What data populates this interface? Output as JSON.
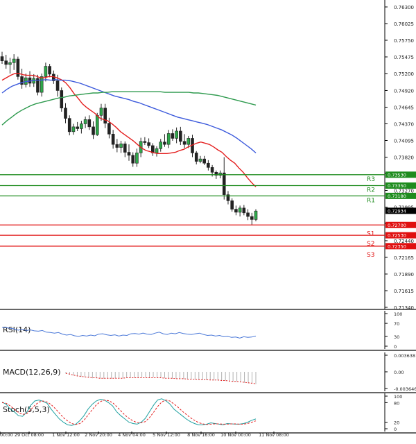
{
  "chart_data": {
    "type": "candlestick",
    "price_axis": {
      "ylim": [
        0.7134,
        0.763
      ],
      "ticks": [
        "0.76300",
        "0.76025",
        "0.75750",
        "0.75475",
        "0.75200",
        "0.74920",
        "0.74645",
        "0.74370",
        "0.74095",
        "0.73820",
        "0.73545",
        "0.73270",
        "0.72995",
        "0.72720",
        "0.72440",
        "0.72165",
        "0.71890",
        "0.71615",
        "0.71340"
      ]
    },
    "x_ticks": [
      "00:00",
      "29 Oct 08:00",
      "1 Nov 12:00",
      "2 Nov 20:00",
      "4 Nov 04:00",
      "5 Nov 12:00",
      "8 Nov 16:00",
      "10 Nov 00:00",
      "11 Nov 08:00"
    ],
    "current_price": {
      "label": "0.72934",
      "value": 0.72934
    },
    "levels": [
      {
        "name": "R3",
        "value": 0.7353,
        "label": "0.73530",
        "color": "#1e8c1e"
      },
      {
        "name": "R2",
        "value": 0.7335,
        "label": "0.73350",
        "color": "#1e8c1e"
      },
      {
        "name": "R1",
        "value": 0.7318,
        "label": "0.73180",
        "color": "#1e8c1e"
      },
      {
        "name": "S1",
        "value": 0.727,
        "label": "0.72700",
        "color": "#e01010"
      },
      {
        "name": "S2",
        "value": 0.7253,
        "label": "0.72530",
        "color": "#e01010"
      },
      {
        "name": "S3",
        "value": 0.7235,
        "label": "0.72350",
        "color": "#e01010"
      }
    ],
    "candles": [
      {
        "o": 0.7548,
        "h": 0.7556,
        "l": 0.7536,
        "c": 0.7541
      },
      {
        "o": 0.7541,
        "h": 0.7551,
        "l": 0.7528,
        "c": 0.7535
      },
      {
        "o": 0.7535,
        "h": 0.7546,
        "l": 0.752,
        "c": 0.7538
      },
      {
        "o": 0.7538,
        "h": 0.7552,
        "l": 0.7526,
        "c": 0.7544
      },
      {
        "o": 0.7544,
        "h": 0.7548,
        "l": 0.751,
        "c": 0.7515
      },
      {
        "o": 0.7515,
        "h": 0.7528,
        "l": 0.7495,
        "c": 0.7502
      },
      {
        "o": 0.7502,
        "h": 0.752,
        "l": 0.7497,
        "c": 0.7513
      },
      {
        "o": 0.7513,
        "h": 0.7524,
        "l": 0.7498,
        "c": 0.7504
      },
      {
        "o": 0.7504,
        "h": 0.7519,
        "l": 0.7498,
        "c": 0.7512
      },
      {
        "o": 0.7512,
        "h": 0.7518,
        "l": 0.7484,
        "c": 0.7489
      },
      {
        "o": 0.7489,
        "h": 0.752,
        "l": 0.7482,
        "c": 0.7515
      },
      {
        "o": 0.7515,
        "h": 0.7538,
        "l": 0.7507,
        "c": 0.7532
      },
      {
        "o": 0.7532,
        "h": 0.7536,
        "l": 0.7514,
        "c": 0.7519
      },
      {
        "o": 0.7519,
        "h": 0.7525,
        "l": 0.7503,
        "c": 0.7508
      },
      {
        "o": 0.7508,
        "h": 0.7518,
        "l": 0.7482,
        "c": 0.7492
      },
      {
        "o": 0.7492,
        "h": 0.7497,
        "l": 0.7457,
        "c": 0.7463
      },
      {
        "o": 0.7463,
        "h": 0.7471,
        "l": 0.7438,
        "c": 0.7446
      },
      {
        "o": 0.7446,
        "h": 0.7451,
        "l": 0.7418,
        "c": 0.7424
      },
      {
        "o": 0.7424,
        "h": 0.7437,
        "l": 0.7419,
        "c": 0.7432
      },
      {
        "o": 0.7432,
        "h": 0.744,
        "l": 0.7425,
        "c": 0.7429
      },
      {
        "o": 0.7429,
        "h": 0.7442,
        "l": 0.7421,
        "c": 0.7437
      },
      {
        "o": 0.7437,
        "h": 0.7449,
        "l": 0.743,
        "c": 0.7444
      },
      {
        "o": 0.7444,
        "h": 0.7451,
        "l": 0.7427,
        "c": 0.7432
      },
      {
        "o": 0.7432,
        "h": 0.7441,
        "l": 0.7412,
        "c": 0.7419
      },
      {
        "o": 0.7419,
        "h": 0.7455,
        "l": 0.7417,
        "c": 0.7451
      },
      {
        "o": 0.7451,
        "h": 0.747,
        "l": 0.7442,
        "c": 0.7463
      },
      {
        "o": 0.7463,
        "h": 0.747,
        "l": 0.743,
        "c": 0.7438
      },
      {
        "o": 0.7438,
        "h": 0.7447,
        "l": 0.7413,
        "c": 0.742
      },
      {
        "o": 0.742,
        "h": 0.7427,
        "l": 0.7396,
        "c": 0.7403
      },
      {
        "o": 0.7403,
        "h": 0.7412,
        "l": 0.739,
        "c": 0.7398
      },
      {
        "o": 0.7398,
        "h": 0.7409,
        "l": 0.7389,
        "c": 0.7404
      },
      {
        "o": 0.7404,
        "h": 0.7408,
        "l": 0.7382,
        "c": 0.739
      },
      {
        "o": 0.739,
        "h": 0.7403,
        "l": 0.7376,
        "c": 0.7385
      },
      {
        "o": 0.7385,
        "h": 0.739,
        "l": 0.7366,
        "c": 0.7372
      },
      {
        "o": 0.7372,
        "h": 0.7396,
        "l": 0.7366,
        "c": 0.7389
      },
      {
        "o": 0.7389,
        "h": 0.7414,
        "l": 0.7382,
        "c": 0.7408
      },
      {
        "o": 0.7408,
        "h": 0.7415,
        "l": 0.7402,
        "c": 0.7406
      },
      {
        "o": 0.7406,
        "h": 0.7413,
        "l": 0.7397,
        "c": 0.7401
      },
      {
        "o": 0.7401,
        "h": 0.7405,
        "l": 0.7384,
        "c": 0.7389
      },
      {
        "o": 0.7389,
        "h": 0.74,
        "l": 0.7383,
        "c": 0.7396
      },
      {
        "o": 0.7396,
        "h": 0.7412,
        "l": 0.7391,
        "c": 0.7407
      },
      {
        "o": 0.7407,
        "h": 0.742,
        "l": 0.7399,
        "c": 0.7403
      },
      {
        "o": 0.7403,
        "h": 0.7427,
        "l": 0.7397,
        "c": 0.7421
      },
      {
        "o": 0.7421,
        "h": 0.7428,
        "l": 0.7409,
        "c": 0.7413
      },
      {
        "o": 0.7413,
        "h": 0.7431,
        "l": 0.7405,
        "c": 0.7425
      },
      {
        "o": 0.7425,
        "h": 0.7432,
        "l": 0.7402,
        "c": 0.7408
      },
      {
        "o": 0.7408,
        "h": 0.742,
        "l": 0.7397,
        "c": 0.7403
      },
      {
        "o": 0.7403,
        "h": 0.7417,
        "l": 0.7397,
        "c": 0.7413
      },
      {
        "o": 0.7413,
        "h": 0.7419,
        "l": 0.7382,
        "c": 0.7389
      },
      {
        "o": 0.7389,
        "h": 0.7392,
        "l": 0.737,
        "c": 0.7375
      },
      {
        "o": 0.7375,
        "h": 0.7384,
        "l": 0.7372,
        "c": 0.7379
      },
      {
        "o": 0.7379,
        "h": 0.7384,
        "l": 0.7369,
        "c": 0.7372
      },
      {
        "o": 0.7372,
        "h": 0.7377,
        "l": 0.736,
        "c": 0.7365
      },
      {
        "o": 0.7365,
        "h": 0.7369,
        "l": 0.735,
        "c": 0.7357
      },
      {
        "o": 0.7357,
        "h": 0.736,
        "l": 0.7346,
        "c": 0.7352
      },
      {
        "o": 0.7352,
        "h": 0.736,
        "l": 0.7347,
        "c": 0.7356
      },
      {
        "o": 0.7356,
        "h": 0.7382,
        "l": 0.7312,
        "c": 0.732
      },
      {
        "o": 0.732,
        "h": 0.7326,
        "l": 0.7304,
        "c": 0.731
      },
      {
        "o": 0.731,
        "h": 0.7314,
        "l": 0.7292,
        "c": 0.7296
      },
      {
        "o": 0.7296,
        "h": 0.7302,
        "l": 0.7286,
        "c": 0.7291
      },
      {
        "o": 0.7291,
        "h": 0.7302,
        "l": 0.7284,
        "c": 0.7298
      },
      {
        "o": 0.7298,
        "h": 0.7303,
        "l": 0.7286,
        "c": 0.729
      },
      {
        "o": 0.729,
        "h": 0.7296,
        "l": 0.7278,
        "c": 0.7284
      },
      {
        "o": 0.7284,
        "h": 0.729,
        "l": 0.727,
        "c": 0.7279
      },
      {
        "o": 0.7279,
        "h": 0.7296,
        "l": 0.7276,
        "c": 0.7293
      }
    ],
    "moving_averages": [
      {
        "color": "#e41e1e",
        "values": [
          0.7509,
          0.7513,
          0.7517,
          0.752,
          0.752,
          0.7518,
          0.7517,
          0.7517,
          0.7516,
          0.7513,
          0.7513,
          0.7515,
          0.7515,
          0.7513,
          0.751,
          0.7505,
          0.7497,
          0.7487,
          0.7479,
          0.747,
          0.7464,
          0.7459,
          0.7454,
          0.7447,
          0.7444,
          0.7442,
          0.7437,
          0.7431,
          0.7424,
          0.7419,
          0.7414,
          0.7409,
          0.7403,
          0.7397,
          0.7393,
          0.7391,
          0.7389,
          0.7388,
          0.7388,
          0.7388,
          0.7389,
          0.739,
          0.7393,
          0.7395,
          0.7399,
          0.7402,
          0.7405,
          0.7407,
          0.7405,
          0.7403,
          0.7399,
          0.7394,
          0.739,
          0.7383,
          0.7377,
          0.7372,
          0.7364,
          0.7357,
          0.7348,
          0.734,
          0.7333
        ]
      },
      {
        "color": "#3c5adc",
        "values": [
          0.7488,
          0.7494,
          0.7499,
          0.7502,
          0.7505,
          0.7507,
          0.7508,
          0.7509,
          0.7509,
          0.751,
          0.7509,
          0.751,
          0.7509,
          0.7509,
          0.7508,
          0.7506,
          0.7504,
          0.7501,
          0.7498,
          0.7495,
          0.7492,
          0.7489,
          0.7486,
          0.7483,
          0.7481,
          0.7479,
          0.7477,
          0.7474,
          0.7472,
          0.7469,
          0.7466,
          0.7463,
          0.746,
          0.7457,
          0.7454,
          0.7451,
          0.7448,
          0.7446,
          0.7444,
          0.7442,
          0.744,
          0.7438,
          0.7436,
          0.7433,
          0.743,
          0.7427,
          0.7423,
          0.7419,
          0.7414,
          0.7408,
          0.7402,
          0.7396,
          0.7389
        ]
      },
      {
        "color": "#2e9a4e",
        "values": [
          0.7435,
          0.7442,
          0.7448,
          0.7454,
          0.7459,
          0.7463,
          0.7467,
          0.747,
          0.7472,
          0.7474,
          0.7476,
          0.7478,
          0.748,
          0.7481,
          0.7483,
          0.7484,
          0.7485,
          0.7486,
          0.7487,
          0.7488,
          0.7488,
          0.7489,
          0.7489,
          0.749,
          0.749,
          0.749,
          0.749,
          0.749,
          0.749,
          0.749,
          0.749,
          0.749,
          0.749,
          0.749,
          0.7489,
          0.7489,
          0.7489,
          0.7489,
          0.7489,
          0.7489,
          0.7488,
          0.7488,
          0.7487,
          0.7486,
          0.7485,
          0.7484,
          0.7482,
          0.748,
          0.7478,
          0.7476,
          0.7474,
          0.7472,
          0.747,
          0.7468
        ]
      }
    ],
    "panels": [
      {
        "key": "rsi",
        "name": "RSI(14)",
        "ticks": [
          "100",
          "70",
          "30",
          "0"
        ],
        "ylim": [
          0,
          100
        ],
        "series": [
          {
            "color": "#4a78d8",
            "values": [
              58,
              57,
              55,
              53,
              49,
              52,
              48,
              50,
              47,
              46,
              48,
              43,
              42,
              40,
              42,
              37,
              34,
              36,
              32,
              30,
              33,
              31,
              34,
              32,
              37,
              38,
              35,
              33,
              35,
              31,
              34,
              33,
              38,
              39,
              37,
              40,
              37,
              36,
              40,
              43,
              38,
              36,
              40,
              38,
              42,
              39,
              37,
              36,
              38,
              40,
              36,
              33,
              34,
              31,
              33,
              29,
              30,
              27,
              28,
              25,
              29,
              27,
              28,
              31
            ]
          }
        ]
      },
      {
        "key": "macd",
        "name": "MACD(12,26,9)",
        "ticks": [
          "0.003638",
          "0.00",
          "-0.003646"
        ],
        "ylim": [
          -0.003646,
          0.003638
        ],
        "histogram": [
          -0.0004,
          -0.0006,
          -0.0008,
          -0.001,
          -0.0011,
          -0.0012,
          -0.0013,
          -0.0014,
          -0.0014,
          -0.0015,
          -0.0015,
          -0.0015,
          -0.0015,
          -0.0014,
          -0.0014,
          -0.0014,
          -0.0013,
          -0.0013,
          -0.0013,
          -0.0012,
          -0.0012,
          -0.0012,
          -0.0012,
          -0.0012,
          -0.0013,
          -0.0013,
          -0.0014,
          -0.0014,
          -0.0015,
          -0.0015,
          -0.0016,
          -0.0016,
          -0.0016,
          -0.0017,
          -0.0017,
          -0.0017,
          -0.0018,
          -0.0018,
          -0.0018,
          -0.0019,
          -0.0019,
          -0.002,
          -0.002,
          -0.0021,
          -0.0022,
          -0.0022,
          -0.0023,
          -0.0024,
          -0.0025,
          -0.0026,
          -0.0027
        ],
        "signal_color": "#e41e1e",
        "signal": [
          -0.0003,
          -0.0005,
          -0.0007,
          -0.0009,
          -0.001,
          -0.0011,
          -0.0012,
          -0.0013,
          -0.0013,
          -0.0014,
          -0.0014,
          -0.0014,
          -0.0014,
          -0.0014,
          -0.0014,
          -0.0014,
          -0.0013,
          -0.0013,
          -0.0013,
          -0.0013,
          -0.0013,
          -0.0013,
          -0.0013,
          -0.0013,
          -0.0013,
          -0.0013,
          -0.0014,
          -0.0014,
          -0.0014,
          -0.0015,
          -0.0015,
          -0.0015,
          -0.0016,
          -0.0016,
          -0.0016,
          -0.0017,
          -0.0017,
          -0.0017,
          -0.0018,
          -0.0018,
          -0.0018,
          -0.0019,
          -0.0019,
          -0.002,
          -0.0021,
          -0.0021,
          -0.0022,
          -0.0023,
          -0.0024,
          -0.0025,
          -0.0026
        ]
      },
      {
        "key": "stoch",
        "name": "Stoch(5,5,3)",
        "ticks": [
          "100",
          "80",
          "20",
          "0"
        ],
        "ylim": [
          0,
          100
        ],
        "series": [
          {
            "color": "#1ea0a0",
            "values": [
              82,
              75,
              60,
              52,
              40,
              38,
              50,
              72,
              85,
              88,
              84,
              78,
              60,
              45,
              30,
              20,
              12,
              10,
              14,
              25,
              40,
              60,
              75,
              85,
              90,
              88,
              80,
              70,
              52,
              40,
              30,
              20,
              16,
              14,
              20,
              32,
              52,
              72,
              88,
              92,
              86,
              76,
              60,
              50,
              40,
              30,
              22,
              16,
              12,
              12,
              14,
              18,
              16,
              14,
              12,
              16,
              15,
              14,
              14,
              16,
              20,
              26,
              30
            ]
          },
          {
            "color": "#e41e1e",
            "dash": true,
            "values": [
              80,
              78,
              70,
              60,
              50,
              44,
              46,
              58,
              72,
              82,
              85,
              82,
              74,
              62,
              48,
              34,
              24,
              16,
              13,
              16,
              26,
              42,
              58,
              73,
              83,
              88,
              86,
              80,
              68,
              55,
              42,
              32,
              24,
              19,
              18,
              22,
              34,
              50,
              68,
              82,
              88,
              85,
              76,
              66,
              54,
              44,
              34,
              26,
              19,
              15,
              13,
              14,
              15,
              15,
              14,
              14,
              15,
              15,
              14,
              14,
              16,
              20,
              24
            ]
          }
        ]
      }
    ]
  }
}
